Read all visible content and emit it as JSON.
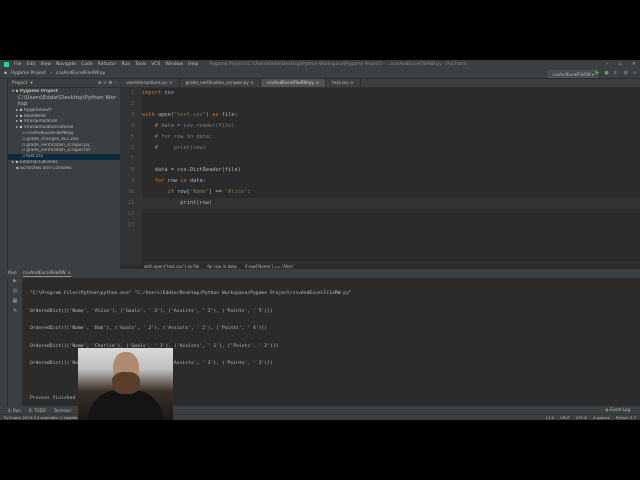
{
  "title_bar": {
    "menus": [
      "File",
      "Edit",
      "View",
      "Navigate",
      "Code",
      "Refactor",
      "Run",
      "Tools",
      "VCS",
      "Window",
      "Help"
    ],
    "title": "Pygame Project [C:\\Users\\Eddie\\Desktop\\Python Workspace\\Pygame Project] - ...\\csvAndExcelFileRW.py - PyCharm"
  },
  "nav": {
    "project": "Pygame Project",
    "file": "csvAndExcelFileRW.py",
    "run_config": "csvAndExcelFileRW"
  },
  "project_panel": {
    "header": "Project",
    "root": "Pygame Project",
    "root_path": "C:\\Users\\Eddie\\Desktop\\Python Worksp",
    "items": [
      "PygameStuff",
      "ReadWrite",
      "VirusSimulation",
      "VirusSimulationTutorial",
      "csvAndExcelFileRW.py",
      "grade_changes_ALL.xlsx",
      "grade_verification_scraper.py",
      "grade_verification_scraper.txt",
      "test.csv",
      "External Libraries",
      "Scratches and Consoles"
    ],
    "selected": "test.csv"
  },
  "tabs": [
    "userInteractions.py",
    "grade_verification_scraper.py",
    "csvAndExcelFileRW.py",
    "test.csv"
  ],
  "active_tab": "csvAndExcelFileRW.py",
  "breadcrumbs": [
    "with open(\"test.csv\") as file",
    "for row in data",
    "if row['Name'] == 'Alice'"
  ],
  "run": {
    "label": "Run",
    "tab": "csvAndExcelFileRW",
    "output": [
      "\"C:\\Program Files\\Python\\python.exe\" \"C:/Users/Eddie/Desktop/Python Workspace/Pygame Project/csvAndExcelFileRW.py\"",
      "OrderedDict([('Name', 'Alice'), ('Goals', ' 3'), ('Assists', ' 2'), ('Points', ' 5')])",
      "OrderedDict([('Name', 'Bob'), ('Goals', ' 2'), ('Assists', ' 2'), ('Points', ' 4')])",
      "OrderedDict([('Name', 'Charlie'), ('Goals', ' 1'), ('Assists', ' 1'), ('Points', ' 2')])",
      "OrderedDict([('Name', 'David'), ('Goals', ' 0'), ('Assists', ' 3'), ('Points', ' 3')])",
      "",
      "Process finished with exit code 0"
    ]
  },
  "bottom_tools": [
    "4: Run",
    "6: TODO",
    "Terminal"
  ],
  "event_log": "Event Log",
  "status": {
    "message": "PyCharm 2019.3.4 available: // Update...",
    "position": "11:5",
    "line_sep": "CRLF",
    "encoding": "UTF-8",
    "indent": "4 spaces",
    "interpreter": "Python 3.7"
  }
}
